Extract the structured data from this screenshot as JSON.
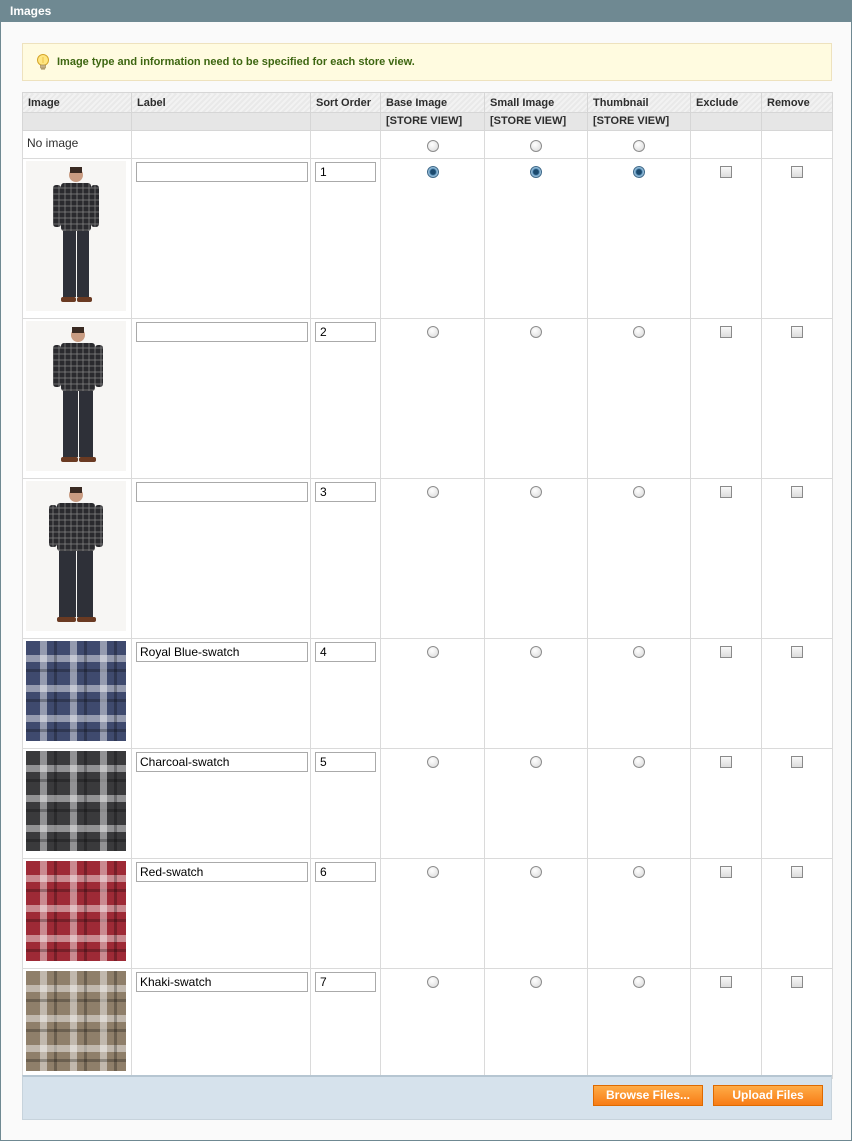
{
  "section": {
    "title": "Images"
  },
  "notice": {
    "text": "Image type and information need to be specified for each store view."
  },
  "columns": {
    "image": "Image",
    "label": "Label",
    "sort_order": "Sort Order",
    "base_image": "Base Image",
    "small_image": "Small Image",
    "thumbnail": "Thumbnail",
    "exclude": "Exclude",
    "remove": "Remove",
    "scope": "[STORE VIEW]"
  },
  "no_image_row": {
    "label": "No image"
  },
  "rows": [
    {
      "image": "model-front",
      "label": "",
      "sort_order": "1",
      "base": true,
      "small": true,
      "thumbnail": true,
      "exclude": false,
      "remove": false
    },
    {
      "image": "model-side",
      "label": "",
      "sort_order": "2",
      "base": false,
      "small": false,
      "thumbnail": false,
      "exclude": false,
      "remove": false
    },
    {
      "image": "model-back",
      "label": "",
      "sort_order": "3",
      "base": false,
      "small": false,
      "thumbnail": false,
      "exclude": false,
      "remove": false
    },
    {
      "image": "swatch-royal-blue",
      "label": "Royal Blue-swatch",
      "sort_order": "4",
      "base": false,
      "small": false,
      "thumbnail": false,
      "exclude": false,
      "remove": false
    },
    {
      "image": "swatch-charcoal",
      "label": "Charcoal-swatch",
      "sort_order": "5",
      "base": false,
      "small": false,
      "thumbnail": false,
      "exclude": false,
      "remove": false
    },
    {
      "image": "swatch-red",
      "label": "Red-swatch",
      "sort_order": "6",
      "base": false,
      "small": false,
      "thumbnail": false,
      "exclude": false,
      "remove": false
    },
    {
      "image": "swatch-khaki",
      "label": "Khaki-swatch",
      "sort_order": "7",
      "base": false,
      "small": false,
      "thumbnail": false,
      "exclude": false,
      "remove": false
    }
  ],
  "buttons": {
    "browse": "Browse Files...",
    "upload": "Upload Files"
  },
  "colors": {
    "header_bar": "#6f8992",
    "button_orange": "#f77c16",
    "notice_bg": "#fffbe0",
    "footer_bg": "#d6e2ec",
    "swatch_royal_blue": "#3f4a6e",
    "swatch_charcoal": "#3a3a3c",
    "swatch_red": "#9e2a36",
    "swatch_khaki": "#8f7f6a"
  }
}
